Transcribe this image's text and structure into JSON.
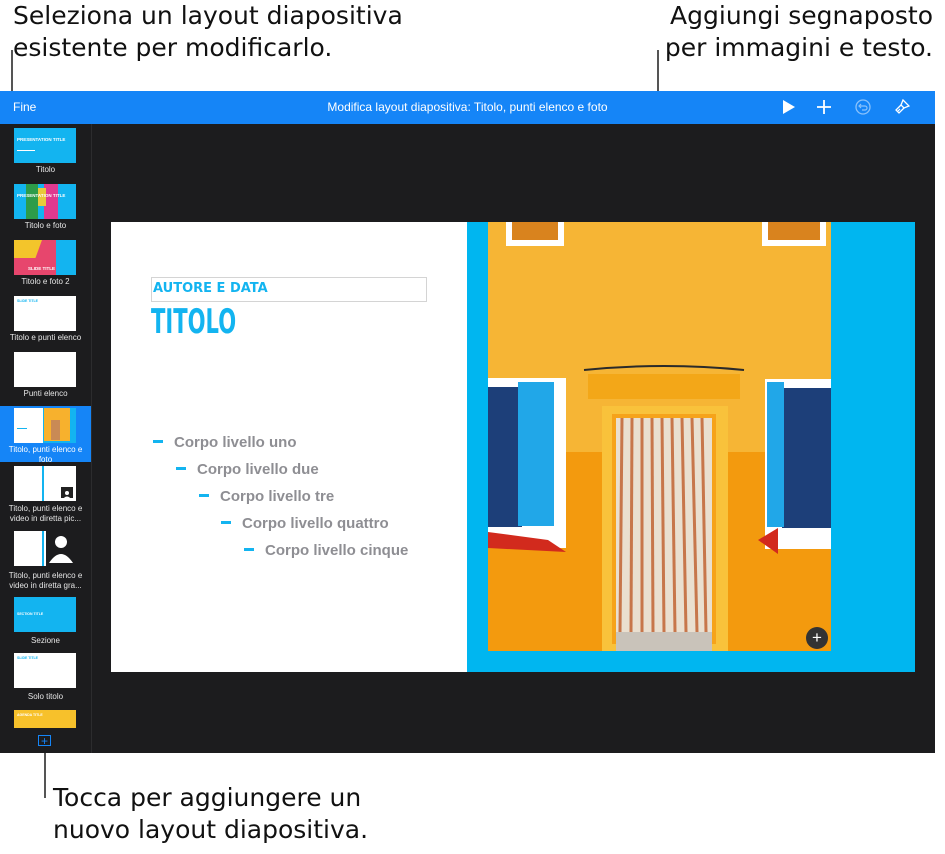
{
  "callouts": {
    "top_left": "Seleziona un layout diapositiva\nesistente per modificarlo.",
    "top_right": "Aggiungi segnaposto\nper immagini e testo.",
    "bottom": "Tocca per aggiungere un\nnuovo layout diapositiva."
  },
  "toolbar": {
    "done_label": "Fine",
    "title": "Modifica layout diapositiva: Titolo, punti elenco e foto",
    "icons": [
      "play-icon",
      "add-icon",
      "undo-icon",
      "format-brush-icon"
    ]
  },
  "sidebar": {
    "items": [
      {
        "label": "Titolo",
        "thumb_text": "PRESENTATION TITLE"
      },
      {
        "label": "Titolo e foto",
        "thumb_text": "PRESENTATION TITLE"
      },
      {
        "label": "Titolo e foto 2",
        "thumb_text": "SLIDE TITLE"
      },
      {
        "label": "Titolo e punti elenco",
        "thumb_text": "SLIDE TITLE"
      },
      {
        "label": "Punti elenco"
      },
      {
        "label": "Titolo, punti elenco e foto"
      },
      {
        "label": "Titolo, punti elenco e video in diretta pic..."
      },
      {
        "label": "Titolo, punti elenco e video in diretta gra..."
      },
      {
        "label": "Sezione",
        "thumb_text": "SECTION TITLE"
      },
      {
        "label": "Solo titolo",
        "thumb_text": "SLIDE TITLE"
      },
      {
        "label": "",
        "thumb_text": "AGENDA TITLE"
      }
    ]
  },
  "slide": {
    "author": "AUTORE E DATA",
    "title": "TITOLO",
    "bullets": [
      "Corpo livello uno",
      "Corpo livello due",
      "Corpo livello tre",
      "Corpo livello quattro",
      "Corpo livello cinque"
    ]
  },
  "colors": {
    "accent": "#1585f7",
    "slide_blue": "#13b4f0",
    "wall_yellow": "#f7b12d"
  }
}
